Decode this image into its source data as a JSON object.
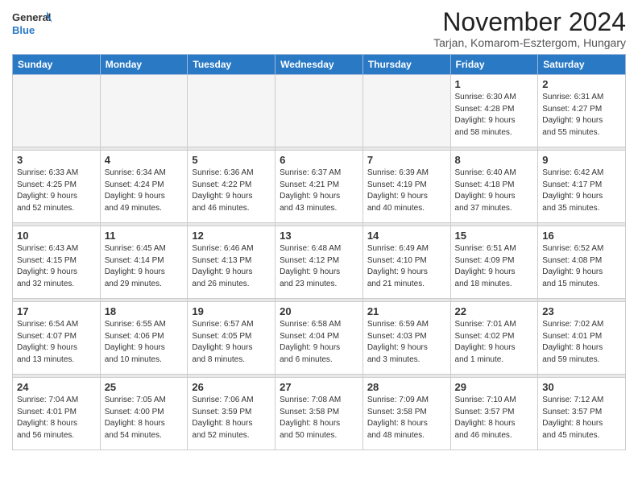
{
  "header": {
    "logo_general": "General",
    "logo_blue": "Blue",
    "month": "November 2024",
    "location": "Tarjan, Komarom-Esztergom, Hungary"
  },
  "days_of_week": [
    "Sunday",
    "Monday",
    "Tuesday",
    "Wednesday",
    "Thursday",
    "Friday",
    "Saturday"
  ],
  "weeks": [
    {
      "days": [
        {
          "num": "",
          "info": ""
        },
        {
          "num": "",
          "info": ""
        },
        {
          "num": "",
          "info": ""
        },
        {
          "num": "",
          "info": ""
        },
        {
          "num": "",
          "info": ""
        },
        {
          "num": "1",
          "info": "Sunrise: 6:30 AM\nSunset: 4:28 PM\nDaylight: 9 hours\nand 58 minutes."
        },
        {
          "num": "2",
          "info": "Sunrise: 6:31 AM\nSunset: 4:27 PM\nDaylight: 9 hours\nand 55 minutes."
        }
      ]
    },
    {
      "days": [
        {
          "num": "3",
          "info": "Sunrise: 6:33 AM\nSunset: 4:25 PM\nDaylight: 9 hours\nand 52 minutes."
        },
        {
          "num": "4",
          "info": "Sunrise: 6:34 AM\nSunset: 4:24 PM\nDaylight: 9 hours\nand 49 minutes."
        },
        {
          "num": "5",
          "info": "Sunrise: 6:36 AM\nSunset: 4:22 PM\nDaylight: 9 hours\nand 46 minutes."
        },
        {
          "num": "6",
          "info": "Sunrise: 6:37 AM\nSunset: 4:21 PM\nDaylight: 9 hours\nand 43 minutes."
        },
        {
          "num": "7",
          "info": "Sunrise: 6:39 AM\nSunset: 4:19 PM\nDaylight: 9 hours\nand 40 minutes."
        },
        {
          "num": "8",
          "info": "Sunrise: 6:40 AM\nSunset: 4:18 PM\nDaylight: 9 hours\nand 37 minutes."
        },
        {
          "num": "9",
          "info": "Sunrise: 6:42 AM\nSunset: 4:17 PM\nDaylight: 9 hours\nand 35 minutes."
        }
      ]
    },
    {
      "days": [
        {
          "num": "10",
          "info": "Sunrise: 6:43 AM\nSunset: 4:15 PM\nDaylight: 9 hours\nand 32 minutes."
        },
        {
          "num": "11",
          "info": "Sunrise: 6:45 AM\nSunset: 4:14 PM\nDaylight: 9 hours\nand 29 minutes."
        },
        {
          "num": "12",
          "info": "Sunrise: 6:46 AM\nSunset: 4:13 PM\nDaylight: 9 hours\nand 26 minutes."
        },
        {
          "num": "13",
          "info": "Sunrise: 6:48 AM\nSunset: 4:12 PM\nDaylight: 9 hours\nand 23 minutes."
        },
        {
          "num": "14",
          "info": "Sunrise: 6:49 AM\nSunset: 4:10 PM\nDaylight: 9 hours\nand 21 minutes."
        },
        {
          "num": "15",
          "info": "Sunrise: 6:51 AM\nSunset: 4:09 PM\nDaylight: 9 hours\nand 18 minutes."
        },
        {
          "num": "16",
          "info": "Sunrise: 6:52 AM\nSunset: 4:08 PM\nDaylight: 9 hours\nand 15 minutes."
        }
      ]
    },
    {
      "days": [
        {
          "num": "17",
          "info": "Sunrise: 6:54 AM\nSunset: 4:07 PM\nDaylight: 9 hours\nand 13 minutes."
        },
        {
          "num": "18",
          "info": "Sunrise: 6:55 AM\nSunset: 4:06 PM\nDaylight: 9 hours\nand 10 minutes."
        },
        {
          "num": "19",
          "info": "Sunrise: 6:57 AM\nSunset: 4:05 PM\nDaylight: 9 hours\nand 8 minutes."
        },
        {
          "num": "20",
          "info": "Sunrise: 6:58 AM\nSunset: 4:04 PM\nDaylight: 9 hours\nand 6 minutes."
        },
        {
          "num": "21",
          "info": "Sunrise: 6:59 AM\nSunset: 4:03 PM\nDaylight: 9 hours\nand 3 minutes."
        },
        {
          "num": "22",
          "info": "Sunrise: 7:01 AM\nSunset: 4:02 PM\nDaylight: 9 hours\nand 1 minute."
        },
        {
          "num": "23",
          "info": "Sunrise: 7:02 AM\nSunset: 4:01 PM\nDaylight: 8 hours\nand 59 minutes."
        }
      ]
    },
    {
      "days": [
        {
          "num": "24",
          "info": "Sunrise: 7:04 AM\nSunset: 4:01 PM\nDaylight: 8 hours\nand 56 minutes."
        },
        {
          "num": "25",
          "info": "Sunrise: 7:05 AM\nSunset: 4:00 PM\nDaylight: 8 hours\nand 54 minutes."
        },
        {
          "num": "26",
          "info": "Sunrise: 7:06 AM\nSunset: 3:59 PM\nDaylight: 8 hours\nand 52 minutes."
        },
        {
          "num": "27",
          "info": "Sunrise: 7:08 AM\nSunset: 3:58 PM\nDaylight: 8 hours\nand 50 minutes."
        },
        {
          "num": "28",
          "info": "Sunrise: 7:09 AM\nSunset: 3:58 PM\nDaylight: 8 hours\nand 48 minutes."
        },
        {
          "num": "29",
          "info": "Sunrise: 7:10 AM\nSunset: 3:57 PM\nDaylight: 8 hours\nand 46 minutes."
        },
        {
          "num": "30",
          "info": "Sunrise: 7:12 AM\nSunset: 3:57 PM\nDaylight: 8 hours\nand 45 minutes."
        }
      ]
    }
  ]
}
